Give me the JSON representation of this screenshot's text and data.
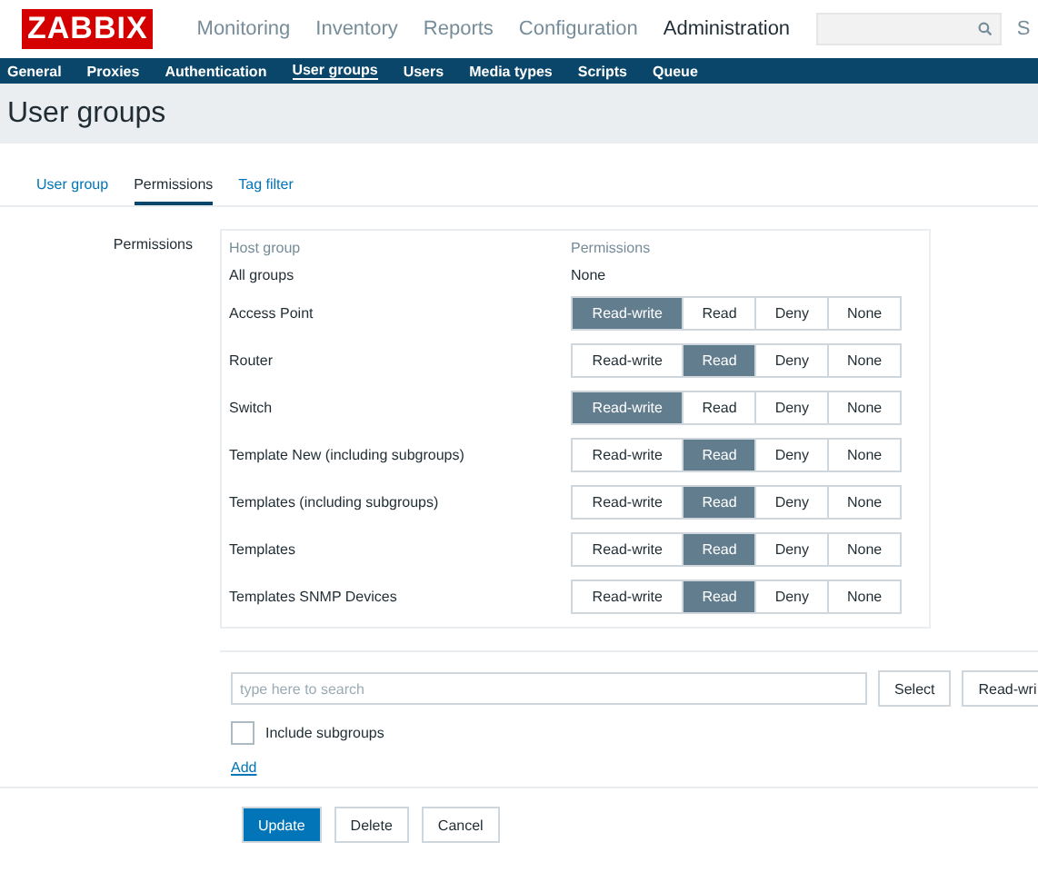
{
  "logo": "ZABBIX",
  "top_menu": [
    {
      "label": "Monitoring",
      "selected": false
    },
    {
      "label": "Inventory",
      "selected": false
    },
    {
      "label": "Reports",
      "selected": false
    },
    {
      "label": "Configuration",
      "selected": false
    },
    {
      "label": "Administration",
      "selected": true
    }
  ],
  "user_menu": "S",
  "sub_menu": [
    {
      "label": "General",
      "selected": false
    },
    {
      "label": "Proxies",
      "selected": false
    },
    {
      "label": "Authentication",
      "selected": false
    },
    {
      "label": "User groups",
      "selected": true
    },
    {
      "label": "Users",
      "selected": false
    },
    {
      "label": "Media types",
      "selected": false
    },
    {
      "label": "Scripts",
      "selected": false
    },
    {
      "label": "Queue",
      "selected": false
    }
  ],
  "page_title": "User groups",
  "tabs": [
    {
      "label": "User group",
      "selected": false
    },
    {
      "label": "Permissions",
      "selected": true
    },
    {
      "label": "Tag filter",
      "selected": false
    }
  ],
  "form_label": "Permissions",
  "table": {
    "columns": [
      "Host group",
      "Permissions"
    ],
    "rows": [
      {
        "group": "All groups",
        "kind": "text",
        "permission": "None"
      },
      {
        "group": "Access Point",
        "kind": "choice",
        "options": [
          {
            "label": "Read-write",
            "selected": true
          },
          {
            "label": "Read",
            "selected": false
          },
          {
            "label": "Deny",
            "selected": false
          },
          {
            "label": "None",
            "selected": false
          }
        ]
      },
      {
        "group": "Router",
        "kind": "choice",
        "options": [
          {
            "label": "Read-write",
            "selected": false
          },
          {
            "label": "Read",
            "selected": true
          },
          {
            "label": "Deny",
            "selected": false
          },
          {
            "label": "None",
            "selected": false
          }
        ]
      },
      {
        "group": "Switch",
        "kind": "choice",
        "options": [
          {
            "label": "Read-write",
            "selected": true
          },
          {
            "label": "Read",
            "selected": false
          },
          {
            "label": "Deny",
            "selected": false
          },
          {
            "label": "None",
            "selected": false
          }
        ]
      },
      {
        "group": "Template New (including subgroups)",
        "kind": "choice",
        "options": [
          {
            "label": "Read-write",
            "selected": false
          },
          {
            "label": "Read",
            "selected": true
          },
          {
            "label": "Deny",
            "selected": false
          },
          {
            "label": "None",
            "selected": false
          }
        ]
      },
      {
        "group": "Templates (including subgroups)",
        "kind": "choice",
        "options": [
          {
            "label": "Read-write",
            "selected": false
          },
          {
            "label": "Read",
            "selected": true
          },
          {
            "label": "Deny",
            "selected": false
          },
          {
            "label": "None",
            "selected": false
          }
        ]
      },
      {
        "group": "Templates",
        "kind": "choice",
        "options": [
          {
            "label": "Read-write",
            "selected": false
          },
          {
            "label": "Read",
            "selected": true
          },
          {
            "label": "Deny",
            "selected": false
          },
          {
            "label": "None",
            "selected": false
          }
        ]
      },
      {
        "group": "Templates SNMP Devices",
        "kind": "choice",
        "options": [
          {
            "label": "Read-write",
            "selected": false
          },
          {
            "label": "Read",
            "selected": true
          },
          {
            "label": "Deny",
            "selected": false
          },
          {
            "label": "None",
            "selected": false
          }
        ]
      }
    ]
  },
  "search": {
    "placeholder": "type here to search"
  },
  "select_button": "Select",
  "partial_button": "Read-wri",
  "include_subgroups": {
    "label": "Include subgroups",
    "checked": false
  },
  "add_link": "Add",
  "actions": [
    {
      "label": "Update",
      "kind": "primary"
    },
    {
      "label": "Delete",
      "kind": "secondary"
    },
    {
      "label": "Cancel",
      "kind": "secondary"
    }
  ]
}
